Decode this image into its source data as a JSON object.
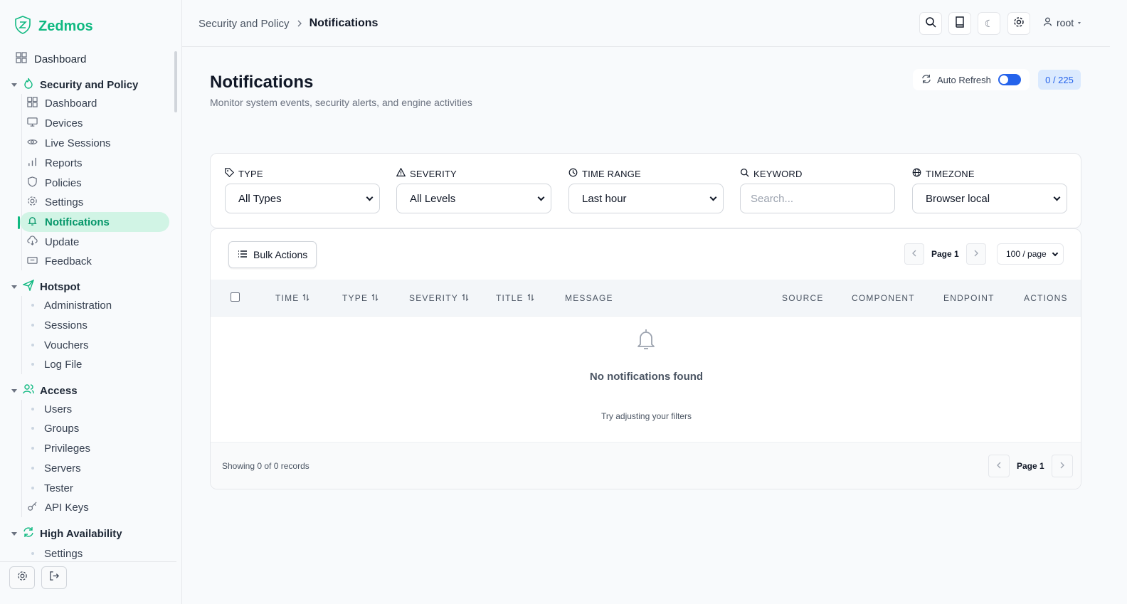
{
  "brand": {
    "name": "Zedmos"
  },
  "sidebar": {
    "dashboard": "Dashboard",
    "groups": [
      {
        "label": "Security and Policy",
        "items": [
          "Dashboard",
          "Devices",
          "Live Sessions",
          "Reports",
          "Policies",
          "Settings",
          "Notifications",
          "Update",
          "Feedback"
        ],
        "active": "Notifications"
      },
      {
        "label": "Hotspot",
        "items": [
          "Administration",
          "Sessions",
          "Vouchers",
          "Log File"
        ]
      },
      {
        "label": "Access",
        "items": [
          "Users",
          "Groups",
          "Privileges",
          "Servers",
          "Tester",
          "API Keys"
        ]
      },
      {
        "label": "High Availability",
        "items": [
          "Settings"
        ]
      }
    ]
  },
  "breadcrumb": {
    "parent": "Security and Policy",
    "current": "Notifications"
  },
  "header": {
    "user": "root",
    "theme_glyph": "☾"
  },
  "page": {
    "title": "Notifications",
    "subtitle": "Monitor system events, security alerts, and engine activities",
    "auto_refresh_label": "Auto Refresh",
    "auto_refresh_on": true,
    "count": "0 / 225"
  },
  "filters": {
    "type": {
      "label": "TYPE",
      "value": "All Types"
    },
    "severity": {
      "label": "SEVERITY",
      "value": "All Levels"
    },
    "time_range": {
      "label": "TIME RANGE",
      "value": "Last hour"
    },
    "keyword": {
      "label": "KEYWORD",
      "placeholder": "Search..."
    },
    "timezone": {
      "label": "TIMEZONE",
      "value": "Browser local"
    }
  },
  "toolbar": {
    "bulk_actions": "Bulk Actions",
    "page_label": "Page 1",
    "per_page": "100 / page"
  },
  "table": {
    "columns": [
      "TIME",
      "TYPE",
      "SEVERITY",
      "TITLE",
      "MESSAGE",
      "SOURCE",
      "COMPONENT",
      "ENDPOINT",
      "ACTIONS"
    ],
    "empty_title": "No notifications found",
    "empty_sub": "Try adjusting your filters"
  },
  "footer": {
    "records": "Showing 0 of 0 records",
    "page_label": "Page 1"
  },
  "colors": {
    "accent": "#10b981",
    "primary": "#2563eb",
    "active_bg": "#d1f4e5"
  }
}
